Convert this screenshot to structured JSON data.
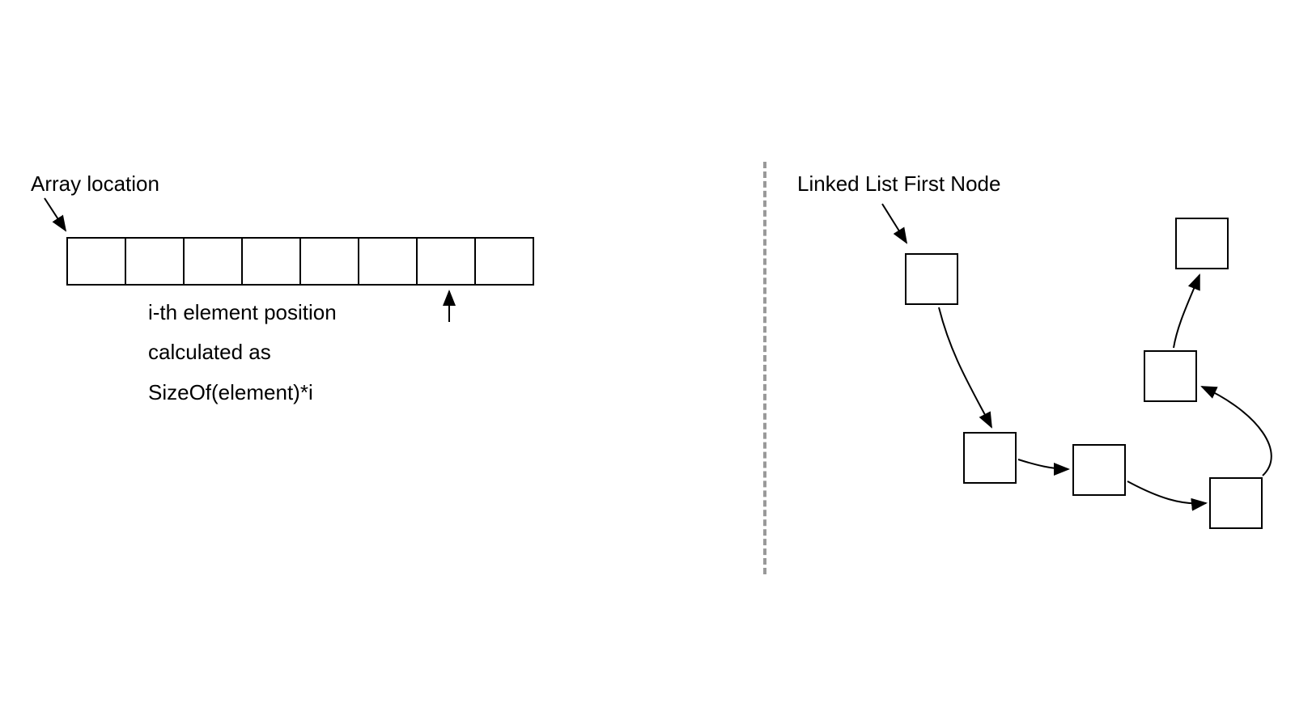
{
  "labels": {
    "array_title": "Array location",
    "list_title": "Linked List First Node",
    "formula_line1": "i-th element position",
    "formula_line2": "calculated as",
    "formula_line3": "SizeOf(element)*i"
  },
  "array": {
    "cell_count": 8
  },
  "linked_list": {
    "node_count": 6
  }
}
